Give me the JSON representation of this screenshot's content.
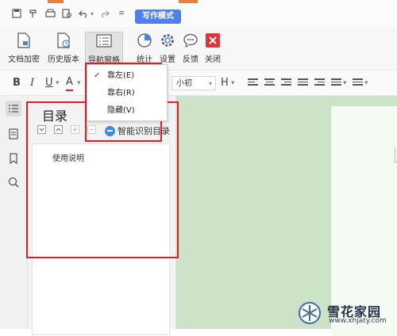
{
  "quick_access": {
    "writing_mode": "写作模式",
    "icons": [
      "save-icon",
      "format-painter-icon",
      "print-icon",
      "print-preview-icon",
      "undo-icon",
      "redo-icon",
      "customize-icon"
    ]
  },
  "ribbon": {
    "buttons": [
      {
        "label": "文档加密",
        "icon": "document-encrypt-icon"
      },
      {
        "label": "历史版本",
        "icon": "history-version-icon"
      },
      {
        "label": "导航窗格",
        "icon": "navigation-pane-icon"
      },
      {
        "label": "统计",
        "icon": "statistics-icon"
      },
      {
        "label": "设置",
        "icon": "settings-gear-icon"
      },
      {
        "label": "反馈",
        "icon": "feedback-icon"
      },
      {
        "label": "关闭",
        "icon": "close-icon"
      }
    ]
  },
  "format_bar": {
    "bold": "B",
    "italic": "I",
    "underline": "U",
    "font_color": "A",
    "font_size": "小初",
    "heading": "H"
  },
  "dropdown": {
    "items": [
      {
        "label": "靠左(E)",
        "checked": true
      },
      {
        "label": "靠右(R)",
        "checked": false
      },
      {
        "label": "隐藏(V)",
        "checked": false
      }
    ]
  },
  "nav_pane": {
    "title": "目录",
    "smart_toc": "智能识别目录",
    "items": [
      "使用说明"
    ]
  },
  "watermark": {
    "name": "雪花家园",
    "url": "www.xhjaty.com"
  },
  "colors": {
    "accent_blue": "#4e80e8",
    "highlight_red": "#e51c23",
    "canvas_green": "#cce3c8"
  }
}
